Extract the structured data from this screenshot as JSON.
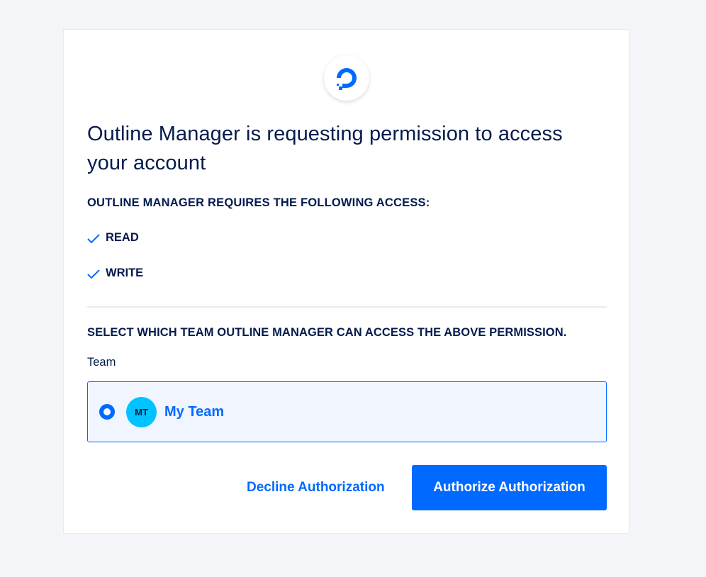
{
  "brand": {
    "logo_icon": "digitalocean-logo-icon",
    "accent_color": "#0069ff",
    "text_color": "#031b4e"
  },
  "heading": {
    "title": "Outline Manager is requesting permission to access your account"
  },
  "access": {
    "requires_label": "OUTLINE MANAGER REQUIRES THE FOLLOWING ACCESS:",
    "permissions": [
      {
        "label": "READ",
        "icon": "check-icon"
      },
      {
        "label": "WRITE",
        "icon": "check-icon"
      }
    ]
  },
  "team_select": {
    "instruction": "SELECT WHICH TEAM OUTLINE MANAGER CAN ACCESS THE ABOVE PERMISSION.",
    "field_label": "Team",
    "options": [
      {
        "initials": "MT",
        "name": "My Team",
        "selected": true
      }
    ]
  },
  "actions": {
    "decline_label": "Decline Authorization",
    "authorize_label": "Authorize Authorization"
  }
}
